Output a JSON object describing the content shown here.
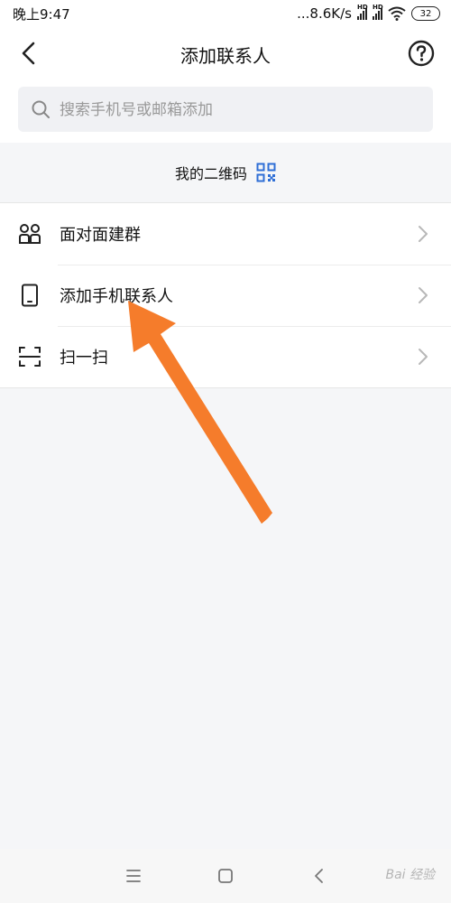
{
  "status_bar": {
    "time": "晚上9:47",
    "net_speed": "...8.6K/s",
    "battery": "32"
  },
  "header": {
    "title": "添加联系人",
    "back_icon": "back-arrow-icon",
    "help_icon": "help-circle-icon"
  },
  "search": {
    "placeholder": "搜索手机号或邮箱添加",
    "value": "",
    "icon": "search-icon"
  },
  "qr": {
    "label": "我的二维码",
    "icon": "qr-code-icon",
    "icon_color": "#2f6fd6"
  },
  "menu": {
    "items": [
      {
        "label": "面对面建群",
        "icon": "people-group-icon"
      },
      {
        "label": "添加手机联系人",
        "icon": "phone-icon"
      },
      {
        "label": "扫一扫",
        "icon": "scan-icon"
      }
    ]
  },
  "annotation": {
    "arrow_color": "#f57c2b"
  },
  "nav": {
    "watermark": "Bai 经验"
  }
}
